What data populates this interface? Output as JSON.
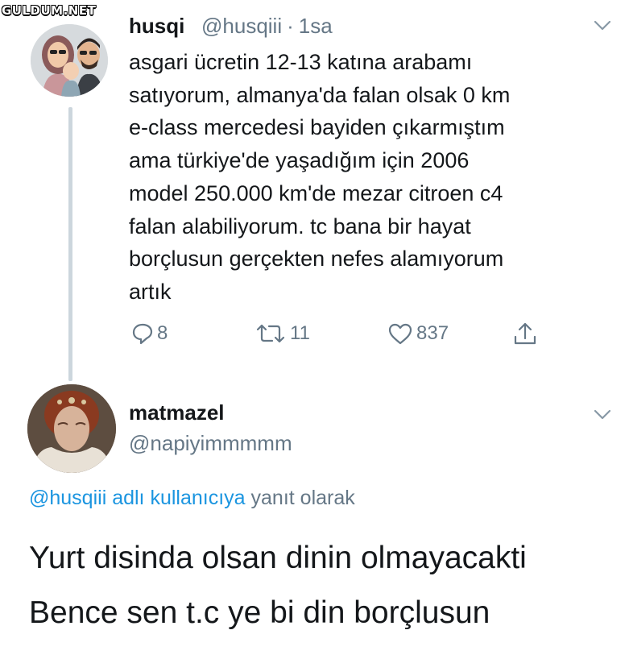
{
  "watermark": "GULDUM.NET",
  "tweet": {
    "display_name": "husqi",
    "handle": "@husqiii",
    "separator": "·",
    "time": "1sa",
    "text_lines": [
      "asgari ücretin 12-13 katına arabamı",
      "satıyorum, almanya'da falan olsak 0 km",
      "e-class mercedesi bayiden çıkarmıştım",
      "ama türkiye'de yaşadığım için 2006",
      "model 250.000 km'de mezar citroen c4",
      "falan alabiliyorum. tc bana bir hayat",
      "borçlusun gerçekten nefes alamıyorum",
      "artık"
    ],
    "actions": {
      "replies": "8",
      "retweets": "11",
      "likes": "837"
    },
    "icons": {
      "reply": "comment-icon",
      "retweet": "retweet-icon",
      "like": "heart-icon",
      "share": "share-icon",
      "menu": "chevron-down-icon"
    }
  },
  "reply": {
    "display_name": "matmazel",
    "handle": "@napiyimmmmm",
    "context_mention": "@husqiii adlı kullanıcıya",
    "context_suffix": "yanıt olarak",
    "text_lines": [
      "Yurt disinda olsan dinin olmayacakti",
      "Bence sen t.c ye bi din borçlusun"
    ]
  },
  "colors": {
    "text": "#14171a",
    "muted": "#657786",
    "link": "#1b95e0",
    "thread_line": "#ccd6dd"
  }
}
